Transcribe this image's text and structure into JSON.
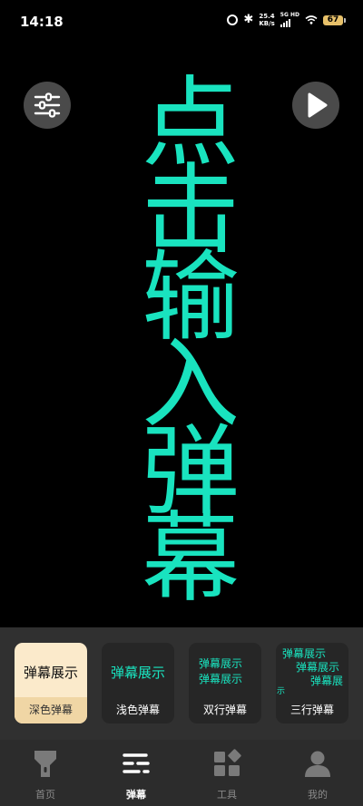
{
  "status_bar": {
    "time": "14:18",
    "network_speed_value": "25.4",
    "network_speed_unit": "KB/s",
    "network_type": "5G HD",
    "battery_level": "67"
  },
  "controls": {
    "settings_icon": "sliders-icon",
    "play_icon": "play-icon"
  },
  "danmaku": {
    "text": "点击输入弹幕",
    "color": "#19e3bf"
  },
  "styles": [
    {
      "preview": [
        "弹幕展示"
      ],
      "label": "深色弹幕",
      "selected": true
    },
    {
      "preview": [
        "弹幕展示"
      ],
      "label": "浅色弹幕"
    },
    {
      "preview": [
        "弹幕展示",
        "弹幕展示"
      ],
      "label": "双行弹幕"
    },
    {
      "preview": [
        "弹幕展示",
        "弹幕展示",
        "弹幕展",
        "示"
      ],
      "label": "三行弹幕"
    }
  ],
  "nav": [
    {
      "label": "首页",
      "icon": "flashlight-icon"
    },
    {
      "label": "弹幕",
      "icon": "danmaku-list-icon",
      "active": true
    },
    {
      "label": "工具",
      "icon": "tools-grid-icon"
    },
    {
      "label": "我的",
      "icon": "profile-icon"
    }
  ]
}
